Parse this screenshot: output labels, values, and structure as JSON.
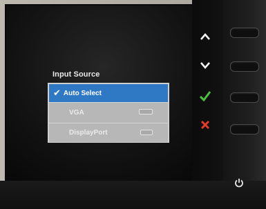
{
  "osd": {
    "title": "Input Source",
    "items": [
      {
        "label": "Auto Select",
        "state": "selected",
        "check": "✔"
      },
      {
        "label": "VGA",
        "state": "disabled",
        "icon": "vga-port-icon"
      },
      {
        "label": "DisplayPort",
        "state": "disabled",
        "icon": "displayport-icon"
      }
    ]
  },
  "side_controls": [
    {
      "icon": "chevron-up-icon"
    },
    {
      "icon": "chevron-down-icon"
    },
    {
      "icon": "check-icon",
      "color": "#4bbf3f"
    },
    {
      "icon": "close-icon",
      "color": "#e23a2e"
    }
  ],
  "colors": {
    "selected_bg": "#2f78c4",
    "disabled_bg": "#b7b7b7",
    "menu_bg": "#ececec",
    "confirm": "#4bbf3f",
    "cancel": "#e23a2e"
  },
  "power": {
    "icon": "power-icon"
  }
}
